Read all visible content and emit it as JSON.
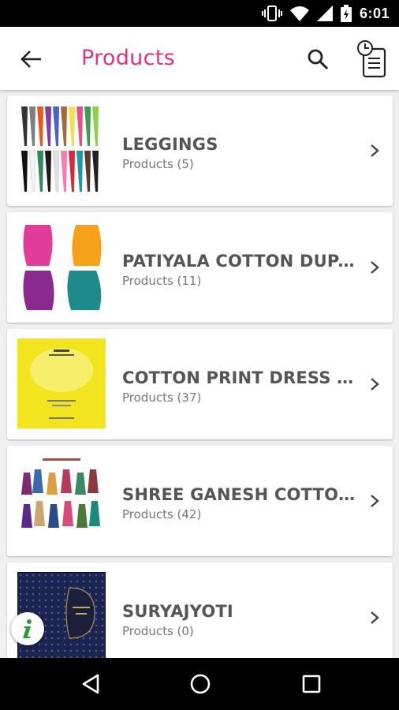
{
  "status_bar": {
    "time": "6:01"
  },
  "header": {
    "title": "Products"
  },
  "categories": [
    {
      "name": "LEGGINGS",
      "count_label": "Products (5)"
    },
    {
      "name": "PATIYALA COTTON DUPATA",
      "count_label": "Products (11)"
    },
    {
      "name": "COTTON PRINT DRESS MATERIAL",
      "count_label": "Products (37)"
    },
    {
      "name": "SHREE GANESH COTTON PRINT",
      "count_label": "Products (42)"
    },
    {
      "name": "SURYAJYOTI",
      "count_label": "Products (0)"
    }
  ],
  "colors": {
    "accent": "#e0337a"
  },
  "icons": [
    "back-arrow-icon",
    "search-icon",
    "history-icon",
    "chevron-right-icon",
    "info-icon",
    "nav-back-icon",
    "nav-home-icon",
    "nav-recents-icon"
  ]
}
